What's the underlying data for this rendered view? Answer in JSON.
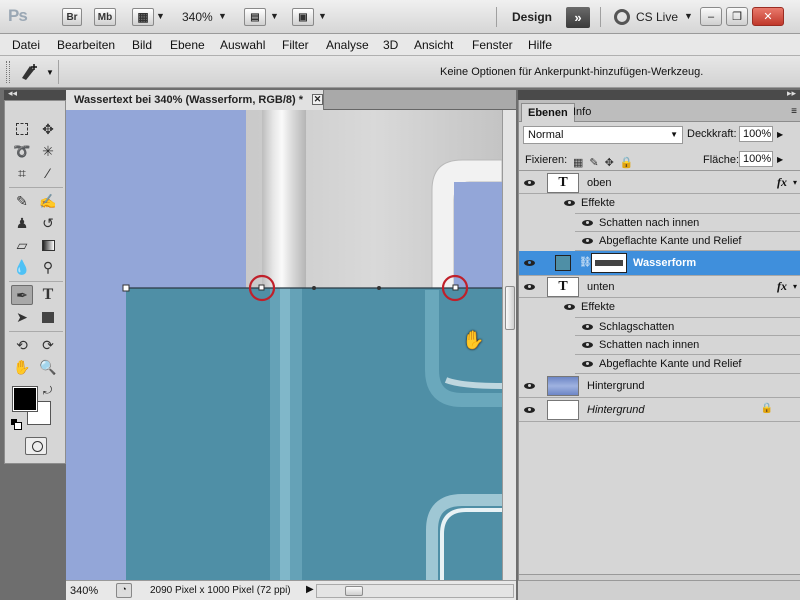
{
  "appbar": {
    "logo": "Ps",
    "bridge_label": "Br",
    "minibridge_label": "Mb",
    "zoom": "340%",
    "workspace": "Design",
    "workspace_more": "»",
    "cs_live": "CS Live",
    "window_minimize": "–",
    "window_restore": "❐",
    "window_close": "✕"
  },
  "menu": [
    "Datei",
    "Bearbeiten",
    "Bild",
    "Ebene",
    "Auswahl",
    "Filter",
    "Analyse",
    "3D",
    "Ansicht",
    "Fenster",
    "Hilfe"
  ],
  "options": {
    "hint": "Keine Optionen für Ankerpunkt-hinzufügen-Werkzeug."
  },
  "document": {
    "tab_title": "Wassertext bei 340% (Wasserform, RGB/8) *",
    "close": "✕"
  },
  "status": {
    "zoom": "340%",
    "info": "2090 Pixel x 1000 Pixel (72 ppi)"
  },
  "layers_panel": {
    "tabs": [
      "Ebenen",
      "Info"
    ],
    "blend_mode": "Normal",
    "opacity_label": "Deckkraft:",
    "opacity_value": "100%",
    "lock_label": "Fixieren:",
    "fill_label": "Fläche:",
    "fill_value": "100%",
    "fx_label": "fx",
    "layers": [
      {
        "name": "oben",
        "type": "text",
        "effects_label": "Effekte",
        "effects": [
          "Schatten nach innen",
          "Abgeflachte Kante und Relief"
        ]
      },
      {
        "name": "Wasserform",
        "type": "shape",
        "selected": true
      },
      {
        "name": "unten",
        "type": "text",
        "effects_label": "Effekte",
        "effects": [
          "Schlagschatten",
          "Schatten nach innen",
          "Abgeflachte Kante und Relief"
        ]
      },
      {
        "name": "Hintergrund",
        "type": "image"
      },
      {
        "name": "Hintergrund",
        "type": "background",
        "locked": true
      }
    ]
  },
  "colors": {
    "selection": "#3f8fdc",
    "water": "#4f8fa6",
    "canvas_bg": "#93a6d8",
    "anchor_circle": "#c0202a"
  }
}
